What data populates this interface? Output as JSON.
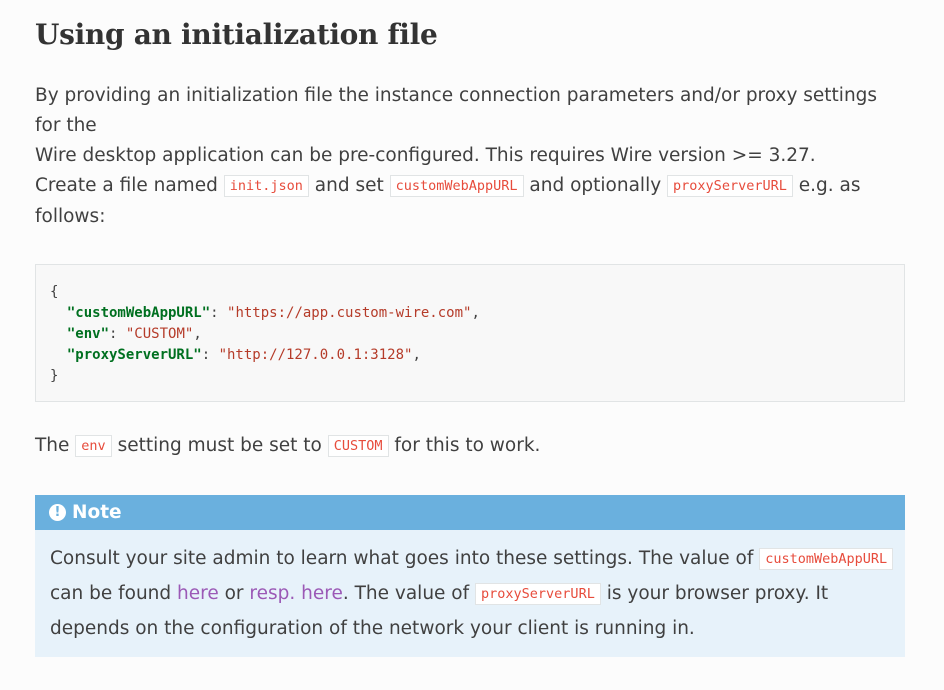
{
  "heading": "Using an initialization file",
  "para1": {
    "line1": "By providing an initialization file the instance connection parameters and/or proxy settings for the",
    "line2": "Wire desktop application can be pre-configured. This requires Wire version >= 3.27."
  },
  "para2": {
    "t1": "Create a file named ",
    "c1": "init.json",
    "t2": " and set ",
    "c2": "customWebAppURL",
    "t3": " and optionally ",
    "c3": "proxyServerURL",
    "t4": " e.g. as follows:"
  },
  "code": {
    "open": "{",
    "k1": "\"customWebAppURL\"",
    "v1": "\"https://app.custom-wire.com\"",
    "k2": "\"env\"",
    "v2": "\"CUSTOM\"",
    "k3": "\"proxyServerURL\"",
    "v3": "\"http://127.0.0.1:3128\"",
    "close": "}"
  },
  "para3": {
    "t1": "The ",
    "c1": "env",
    "t2": " setting must be set to ",
    "c2": "CUSTOM",
    "t3": " for this to work."
  },
  "note": {
    "icon": "!",
    "title": "Note",
    "t1": "Consult your site admin to learn what goes into these settings. The value of ",
    "c1": "customWebAppURL",
    "t2": " can be found ",
    "link1": "here",
    "t3": " or ",
    "link2": "resp. here",
    "t4": ". The value of ",
    "c2": "proxyServerURL",
    "t5": " is your browser proxy. It depends on the configuration of the network your client is running in."
  }
}
